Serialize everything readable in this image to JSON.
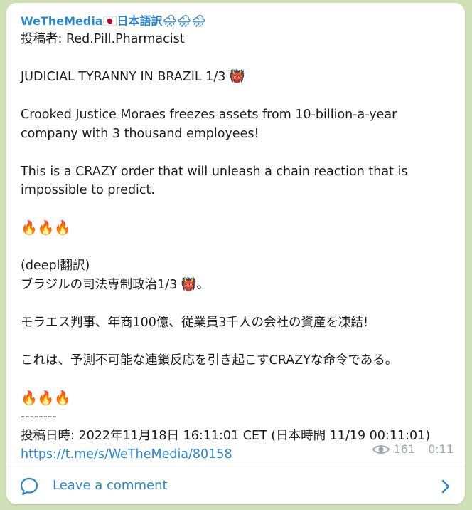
{
  "message": {
    "channel_name": "WeTheMedia🇯🇵日本語訳🌧🌧🌧",
    "lines": [
      "投稿者: Red.Pill.Pharmacist",
      "",
      "JUDICIAL TYRANNY IN BRAZIL 1/3 👹",
      "",
      "Crooked Justice Moraes freezes assets from 10-billion-a-year",
      "company with 3 thousand employees!",
      "",
      "This is a CRAZY order that will unleash a chain reaction that is",
      "impossible to predict.",
      "",
      "🔥🔥🔥",
      "",
      "(deepl翻訳)",
      "ブラジルの司法専制政治1/3 👹。",
      "",
      "モラエス判事、年商100億、従業員3千人の会社の資産を凍結!",
      "",
      "これは、予測不可能な連鎖反応を引き起こすCRAZYな命令である。",
      "",
      "🔥🔥🔥",
      "--------",
      "投稿日時: 2022年11月18日 16:11:01 CET (日本時間 11/19 00:11:01)"
    ],
    "link": "https://t.me/s/WeTheMedia/80158",
    "views": "161",
    "time": "0:11"
  },
  "footer": {
    "comment_label": "Leave a comment"
  },
  "colors": {
    "accent": "#2a86cf",
    "background": "#cfe0b6",
    "meta": "#a0a6ab"
  },
  "icons": {
    "views": "eye-icon",
    "comment": "comment-bubble-icon",
    "open": "chevron-right-icon"
  }
}
